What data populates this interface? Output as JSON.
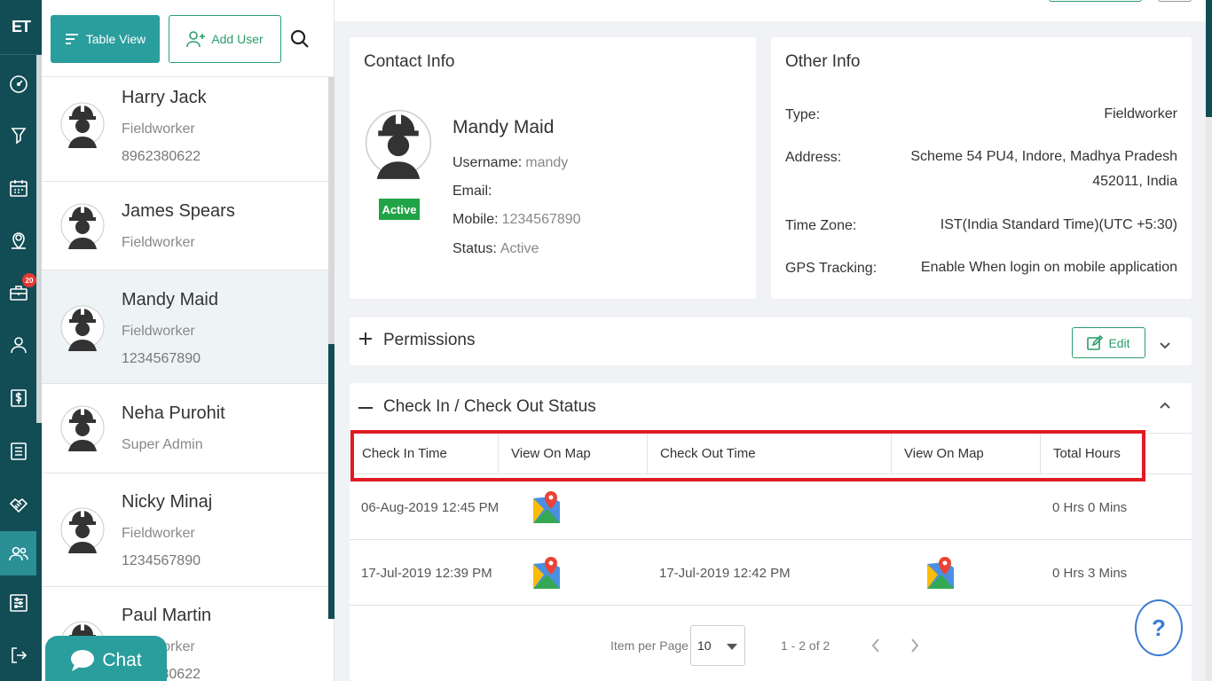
{
  "rail": {
    "logo": "ET",
    "badge_count": "20"
  },
  "toolbar": {
    "table_view_label": "Table View",
    "add_user_label": "Add User"
  },
  "users": [
    {
      "name": "Harry Jack",
      "role": "Fieldworker",
      "phone": "8962380622"
    },
    {
      "name": "James Spears",
      "role": "Fieldworker",
      "phone": ""
    },
    {
      "name": "Mandy Maid",
      "role": "Fieldworker",
      "phone": "1234567890"
    },
    {
      "name": "Neha Purohit",
      "role": "Super Admin",
      "phone": ""
    },
    {
      "name": "Nicky Minaj",
      "role": "Fieldworker",
      "phone": "1234567890"
    },
    {
      "name": "Paul Martin",
      "role": "Fieldworker",
      "phone": "8962380622"
    }
  ],
  "chat_label": "Chat",
  "contact": {
    "title": "Contact Info",
    "name": "Mandy Maid",
    "status_tag": "Active",
    "username_label": "Username:",
    "username": "mandy",
    "email_label": "Email:",
    "email": "",
    "mobile_label": "Mobile:",
    "mobile": "1234567890",
    "status_label": "Status:",
    "status": "Active"
  },
  "other": {
    "title": "Other Info",
    "type_label": "Type:",
    "type": "Fieldworker",
    "address_label": "Address:",
    "address_line1": "Scheme 54 PU4, Indore, Madhya Pradesh",
    "address_line2": "452011, India",
    "timezone_label": "Time Zone:",
    "timezone": "IST(India Standard Time)(UTC +5:30)",
    "gps_label": "GPS Tracking:",
    "gps": "Enable When login on mobile application"
  },
  "permissions": {
    "title": "Permissions",
    "edit_label": "Edit"
  },
  "checkin": {
    "title": "Check In / Check Out Status",
    "columns": [
      "Check In Time",
      "View On Map",
      "Check Out Time",
      "View On Map",
      "Total Hours"
    ],
    "rows": [
      {
        "check_in": "06-Aug-2019 12:45 PM",
        "check_out": "",
        "total": "0 Hrs 0 Mins"
      },
      {
        "check_in": "17-Jul-2019 12:39 PM",
        "check_out": "17-Jul-2019 12:42 PM",
        "total": "0 Hrs 3 Mins"
      }
    ],
    "items_per_page_label": "Item per Page",
    "items_per_page": "10",
    "range": "1 - 2 of 2"
  },
  "help_label": "?",
  "colors": {
    "rail": "#124c55",
    "accent": "#2a9d9d",
    "active_tag": "#21a347",
    "highlight": "#e01b24",
    "help": "#3a7bd5"
  }
}
